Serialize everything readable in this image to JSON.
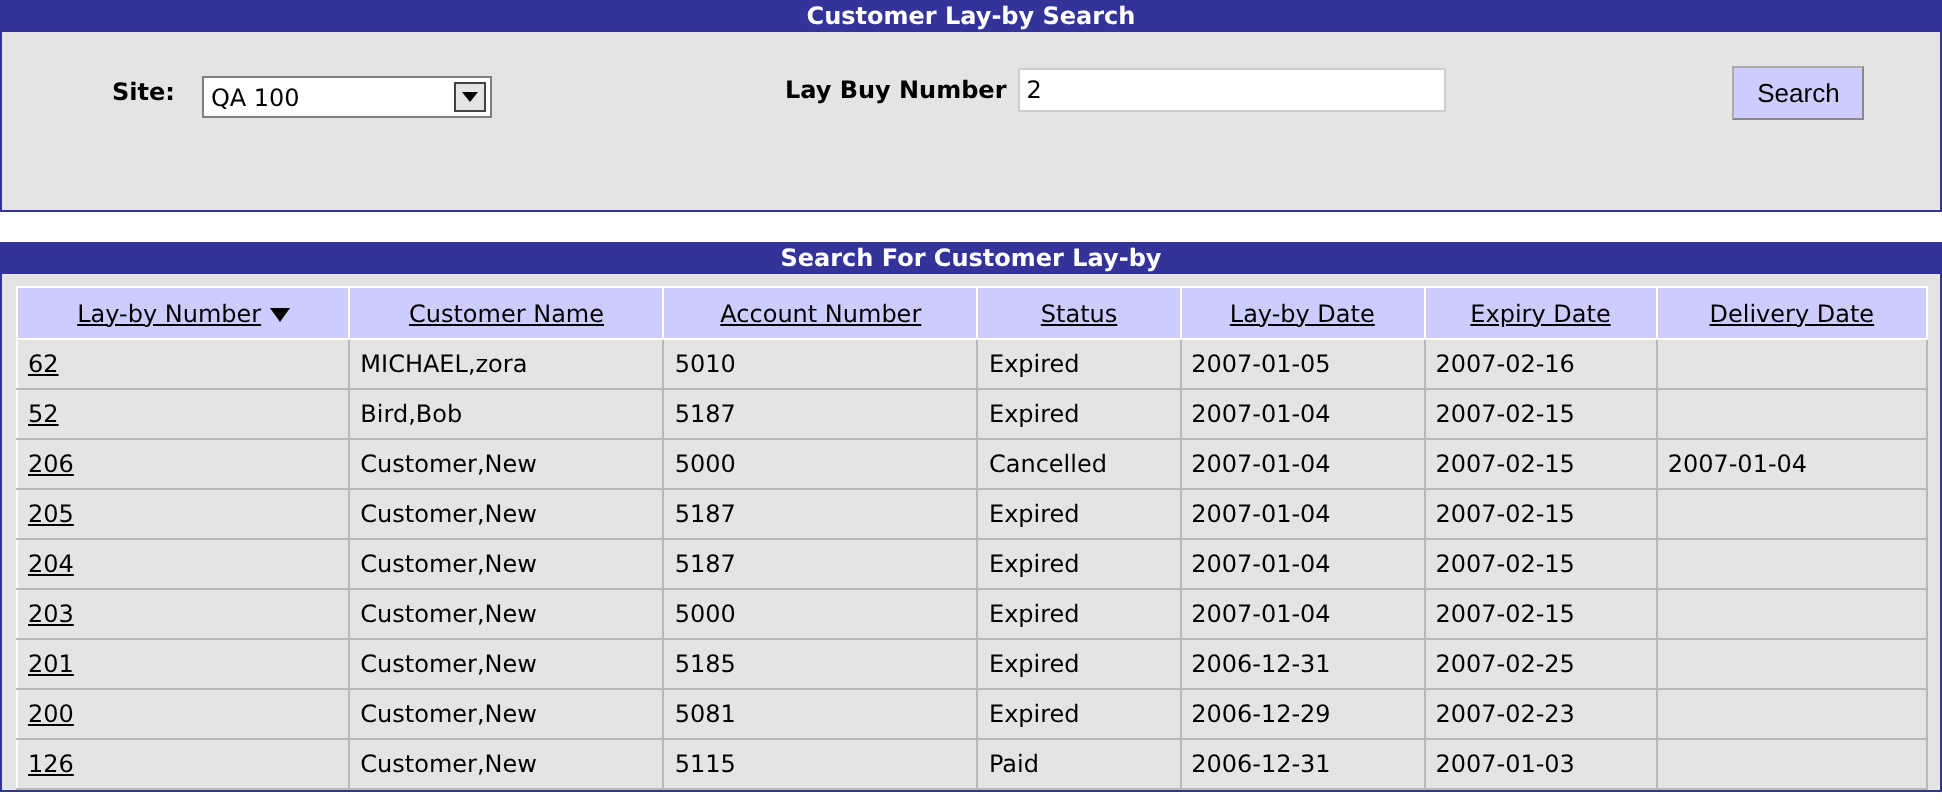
{
  "search_panel": {
    "title": "Customer Lay-by Search",
    "site": {
      "label": "Site:",
      "value": "QA 100"
    },
    "lay_buy_number": {
      "label": "Lay Buy Number",
      "value": "2"
    },
    "search_button": "Search"
  },
  "results": {
    "title": "Search For Customer Lay-by",
    "columns": [
      {
        "label": "Lay-by Number",
        "sorted": true
      },
      {
        "label": "Customer Name",
        "sorted": false
      },
      {
        "label": "Account Number",
        "sorted": false
      },
      {
        "label": "Status",
        "sorted": false
      },
      {
        "label": "Lay-by Date",
        "sorted": false
      },
      {
        "label": "Expiry Date",
        "sorted": false
      },
      {
        "label": "Delivery Date",
        "sorted": false
      }
    ],
    "rows": [
      [
        "62",
        "MICHAEL,zora",
        "5010",
        "Expired",
        "2007-01-05",
        "2007-02-16",
        ""
      ],
      [
        "52",
        "Bird,Bob",
        "5187",
        "Expired",
        "2007-01-04",
        "2007-02-15",
        ""
      ],
      [
        "206",
        "Customer,New",
        "5000",
        "Cancelled",
        "2007-01-04",
        "2007-02-15",
        "2007-01-04"
      ],
      [
        "205",
        "Customer,New",
        "5187",
        "Expired",
        "2007-01-04",
        "2007-02-15",
        ""
      ],
      [
        "204",
        "Customer,New",
        "5187",
        "Expired",
        "2007-01-04",
        "2007-02-15",
        ""
      ],
      [
        "203",
        "Customer,New",
        "5000",
        "Expired",
        "2007-01-04",
        "2007-02-15",
        ""
      ],
      [
        "201",
        "Customer,New",
        "5185",
        "Expired",
        "2006-12-31",
        "2007-02-25",
        ""
      ],
      [
        "200",
        "Customer,New",
        "5081",
        "Expired",
        "2006-12-29",
        "2007-02-23",
        ""
      ],
      [
        "126",
        "Customer,New",
        "5115",
        "Paid",
        "2006-12-31",
        "2007-01-03",
        ""
      ]
    ]
  }
}
